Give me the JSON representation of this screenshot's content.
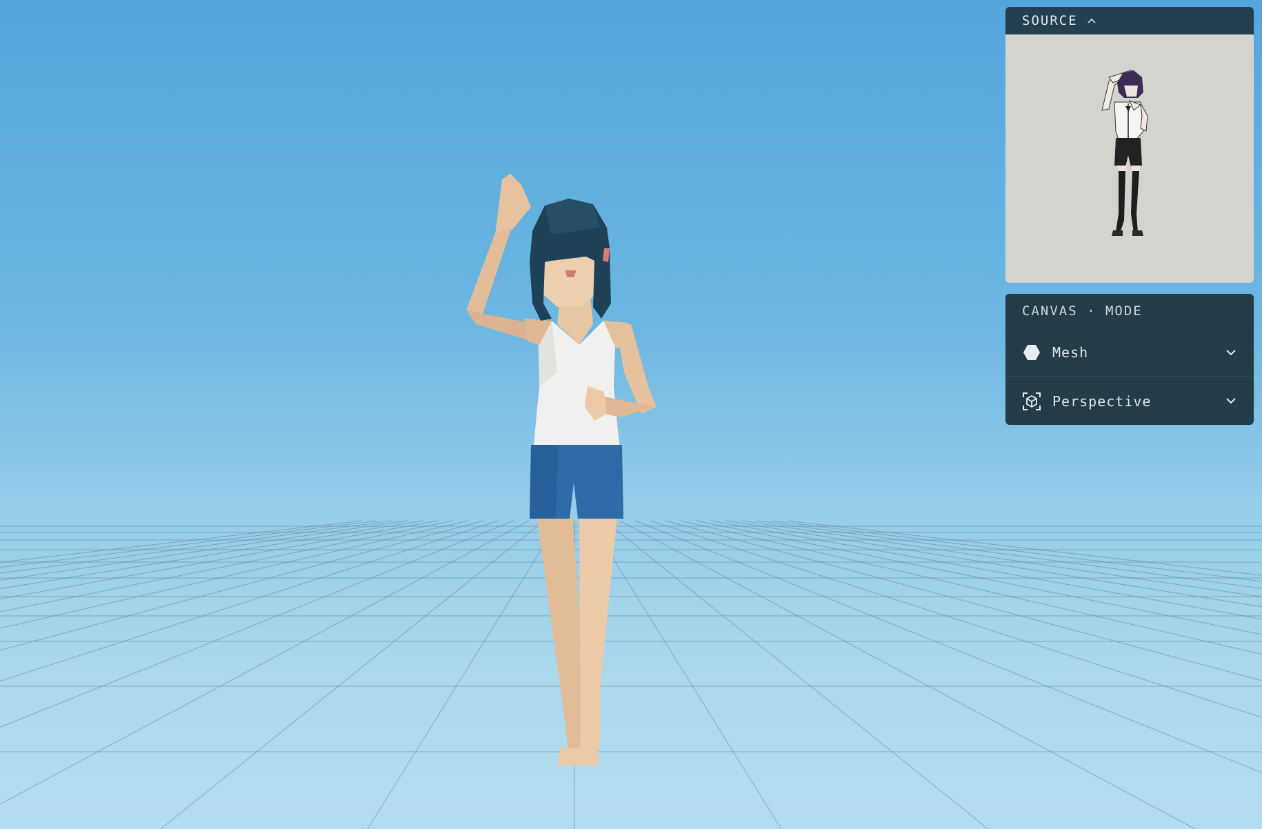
{
  "source_panel": {
    "title": "SOURCE"
  },
  "canvas_panel": {
    "heading": "CANVAS · MODE",
    "mesh_label": "Mesh",
    "view_label": "Perspective"
  },
  "colors": {
    "panel_bg": "#243b48",
    "panel_header": "#243f50",
    "sky_top": "#53a6dc",
    "floor": "#b3ddee",
    "skin": "#e8c7a6",
    "hair": "#1f4258",
    "shorts": "#2e6aa8",
    "tank_top": "#f1f1ef"
  },
  "icons": [
    "chevron-up-icon",
    "hexagon-mesh-icon",
    "perspective-cube-icon",
    "chevron-down-icon"
  ]
}
